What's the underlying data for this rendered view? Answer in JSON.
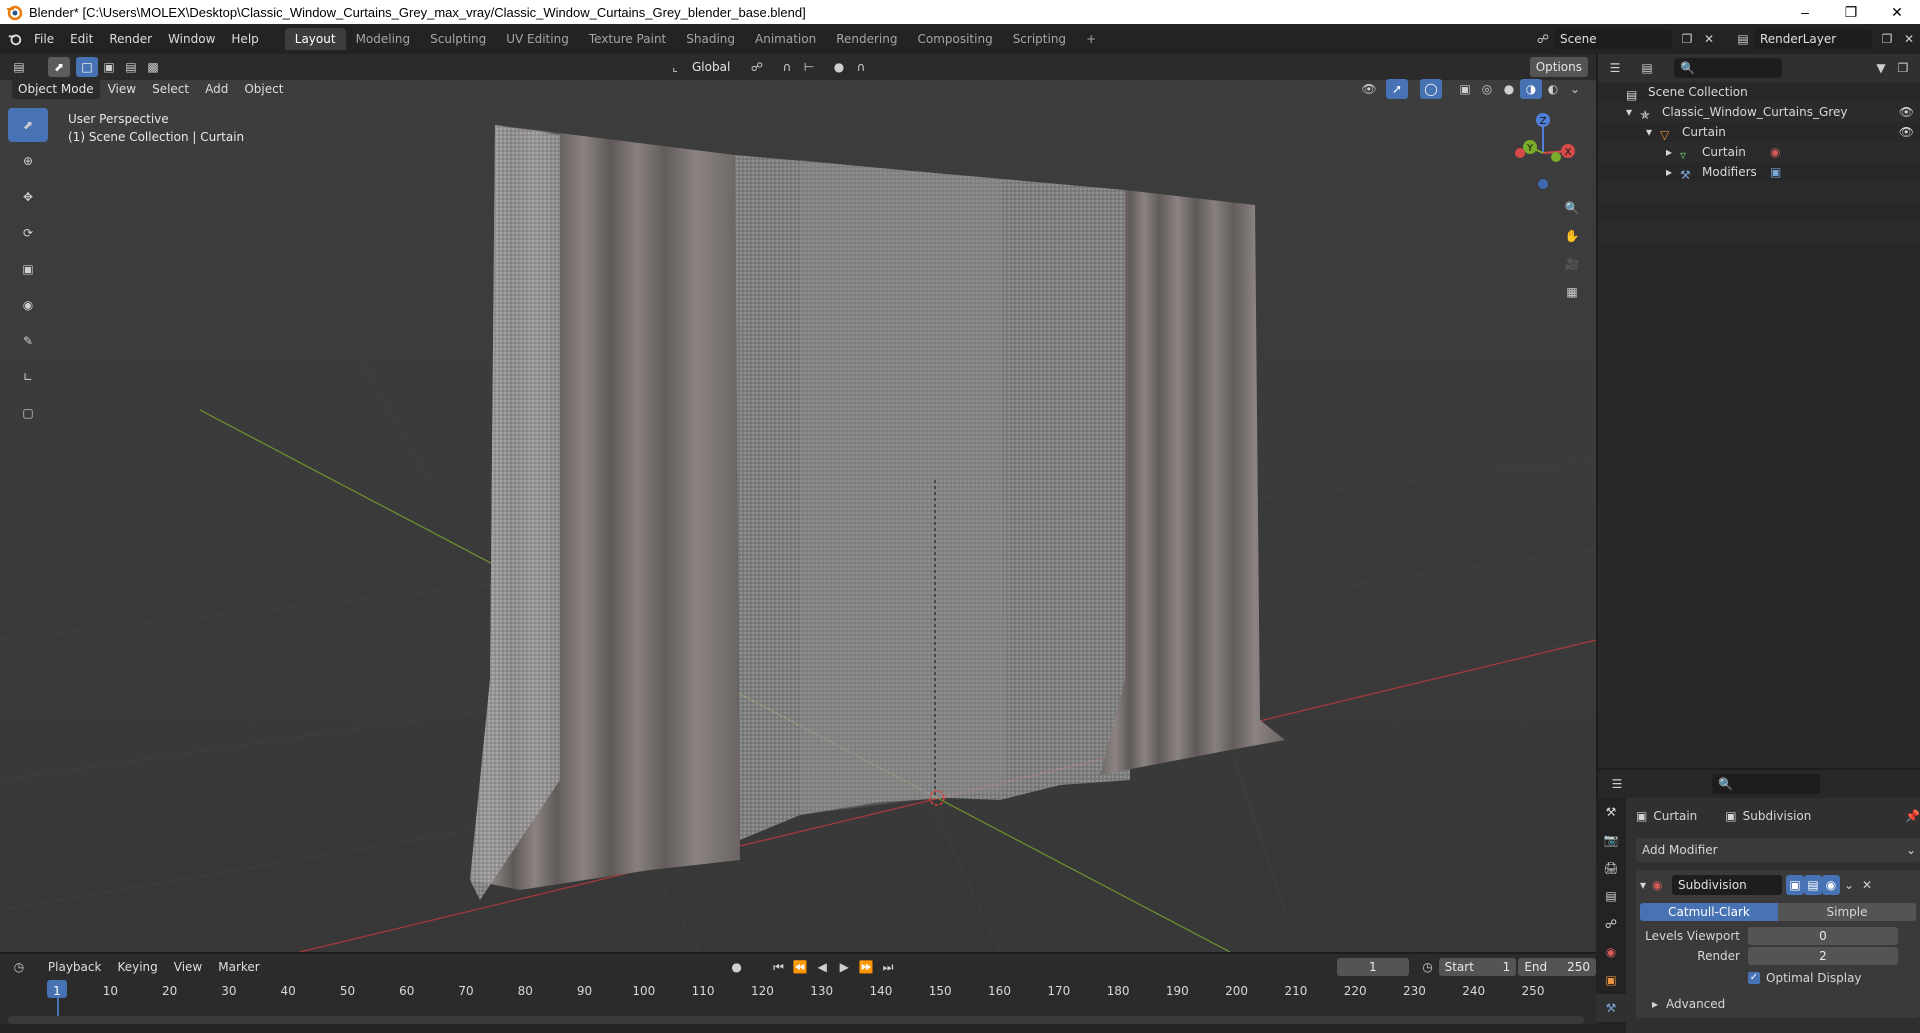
{
  "app": {
    "window_title": "Blender* [C:\\Users\\MOLEX\\Desktop\\Classic_Window_Curtains_Grey_max_vray/Classic_Window_Curtains_Grey_blender_base.blend]"
  },
  "menu": [
    "File",
    "Edit",
    "Render",
    "Window",
    "Help"
  ],
  "workspaces": [
    {
      "label": "Layout",
      "active": true
    },
    {
      "label": "Modeling"
    },
    {
      "label": "Sculpting"
    },
    {
      "label": "UV Editing"
    },
    {
      "label": "Texture Paint"
    },
    {
      "label": "Shading"
    },
    {
      "label": "Animation"
    },
    {
      "label": "Rendering"
    },
    {
      "label": "Compositing"
    },
    {
      "label": "Scripting"
    }
  ],
  "add_workspace": "+",
  "scene": {
    "name": "Scene",
    "render_layer": "RenderLayer"
  },
  "viewport": {
    "transform_orientation": "Global",
    "options_label": "Options",
    "mode": "Object Mode",
    "header_menus": [
      "View",
      "Select",
      "Add",
      "Object"
    ],
    "info_line1": "User Perspective",
    "info_line2": "(1) Scene Collection | Curtain",
    "gizmo_axes": {
      "z": "Z",
      "y": "Y",
      "x": "X"
    },
    "colors": {
      "bg": "#3d3d3d",
      "x_axis": "#c03a3a",
      "y_axis": "#7bab2a",
      "accent": "#4772b3"
    }
  },
  "tools": [
    "select-box-icon",
    "cursor-icon",
    "move-icon",
    "rotate-icon",
    "scale-icon",
    "transform-icon",
    "annotate-icon",
    "measure-icon",
    "add-cube-icon"
  ],
  "outliner": {
    "root": "Scene Collection",
    "items": [
      {
        "label": "Classic_Window_Curtains_Grey",
        "depth": 1,
        "icon": "collection-icon"
      },
      {
        "label": "Curtain",
        "depth": 2,
        "icon": "object-icon"
      },
      {
        "label": "Curtain",
        "depth": 3,
        "icon": "mesh-icon"
      },
      {
        "label": "Modifiers",
        "depth": 3,
        "icon": "wrench-icon"
      }
    ]
  },
  "properties": {
    "object_name": "Curtain",
    "modifier_breadcrumb": "Subdivision",
    "add_modifier": "Add Modifier",
    "modifier": {
      "name": "Subdivision",
      "types": [
        "Catmull-Clark",
        "Simple"
      ],
      "active_type": "Catmull-Clark",
      "levels_viewport_label": "Levels Viewport",
      "levels_viewport": "0",
      "render_label": "Render",
      "render": "2",
      "optimal_display_label": "Optimal Display",
      "optimal_display": true,
      "advanced_label": "Advanced"
    }
  },
  "timeline": {
    "menus": [
      "Playback",
      "Keying",
      "View",
      "Marker"
    ],
    "current_frame": "1",
    "start_label": "Start",
    "start": "1",
    "end_label": "End",
    "end": "250",
    "ticks": [
      "1",
      "10",
      "20",
      "30",
      "40",
      "50",
      "60",
      "70",
      "80",
      "90",
      "100",
      "110",
      "120",
      "130",
      "140",
      "150",
      "160",
      "170",
      "180",
      "190",
      "200",
      "210",
      "220",
      "230",
      "240",
      "250"
    ]
  }
}
